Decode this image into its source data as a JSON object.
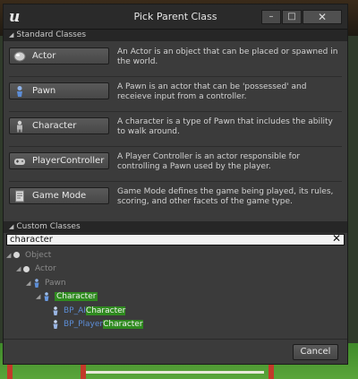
{
  "window": {
    "title": "Pick Parent Class",
    "logo_text": "u",
    "minimize_glyph": "–",
    "maximize_glyph": "□",
    "close_glyph": "✕"
  },
  "standard": {
    "header": "Standard Classes",
    "items": [
      {
        "label": "Actor",
        "icon": "sphere-icon",
        "description": "An Actor is an object that can be placed or spawned in the world."
      },
      {
        "label": "Pawn",
        "icon": "pawn-icon",
        "description": "A Pawn is an actor that can be 'possessed' and receieve input from a controller."
      },
      {
        "label": "Character",
        "icon": "character-icon",
        "description": "A character is a type of Pawn that includes the ability to walk around."
      },
      {
        "label": "PlayerController",
        "icon": "gamepad-icon",
        "description": "A Player Controller is an actor responsible for controlling a Pawn used by the player."
      },
      {
        "label": "Game Mode",
        "icon": "document-icon",
        "description": "Game Mode defines the game being played, its rules, scoring, and other facets of the game type."
      }
    ]
  },
  "custom": {
    "header": "Custom Classes",
    "search_value": "character",
    "clear_glyph": "✕",
    "tree": {
      "object": "Object",
      "actor": "Actor",
      "pawn": "Pawn",
      "character": "Character",
      "bp_ai_prefix": "BP_AI",
      "bp_ai_match": "Character",
      "bp_player_prefix": "BP_Player",
      "bp_player_match": "Character"
    }
  },
  "footer": {
    "cancel_label": "Cancel"
  },
  "colors": {
    "highlight": "#2f8a1f",
    "blueprint_text": "#5c8dd6"
  }
}
